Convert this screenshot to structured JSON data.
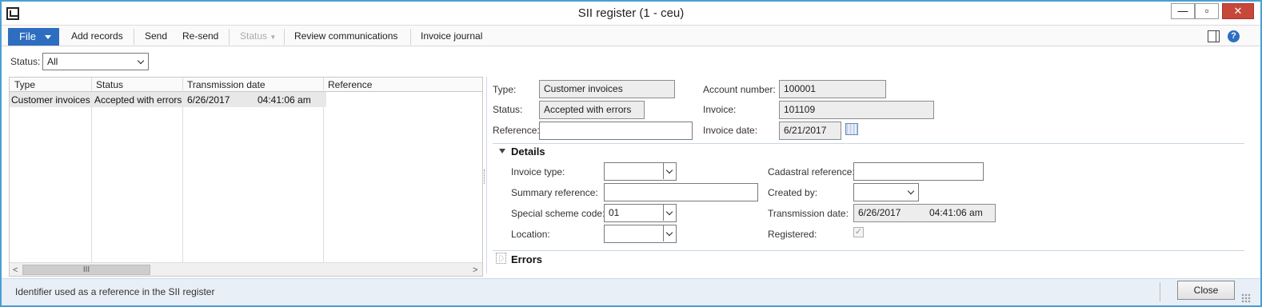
{
  "window": {
    "title": "SII register (1 - ceu)",
    "controls": {
      "minimize": "—",
      "maximize": "▫",
      "close": "✕"
    }
  },
  "ribbon": {
    "file": "File",
    "add_records": "Add records",
    "send": "Send",
    "resend": "Re-send",
    "status": "Status",
    "review": "Review communications",
    "invoice_journal": "Invoice journal",
    "help": "?"
  },
  "filter": {
    "label": "Status:",
    "value": "All"
  },
  "grid": {
    "columns": [
      "Type",
      "Status",
      "Transmission date",
      "Reference"
    ],
    "rows": [
      {
        "type": "Customer invoices",
        "status": "Accepted with errors",
        "date": "6/26/2017",
        "time": "04:41:06 am",
        "reference": ""
      }
    ],
    "scroll": {
      "left": "<",
      "thumb": "III",
      "right": ">"
    }
  },
  "header_fields": {
    "type_label": "Type:",
    "type_value": "Customer invoices",
    "status_label": "Status:",
    "status_value": "Accepted with errors",
    "reference_label": "Reference:",
    "reference_value": "",
    "account_label": "Account number:",
    "account_value": "100001",
    "invoice_label": "Invoice:",
    "invoice_value": "101109",
    "invoice_date_label": "Invoice date:",
    "invoice_date_value": "6/21/2017"
  },
  "details": {
    "title": "Details",
    "invoice_type_label": "Invoice type:",
    "invoice_type_value": "",
    "summary_ref_label": "Summary reference:",
    "summary_ref_value": "",
    "special_scheme_label": "Special scheme code:",
    "special_scheme_value": "01",
    "location_label": "Location:",
    "location_value": "",
    "cadastral_label": "Cadastral reference:",
    "cadastral_value": "",
    "created_by_label": "Created by:",
    "created_by_value": "",
    "transmission_label": "Transmission date:",
    "transmission_date": "6/26/2017",
    "transmission_time": "04:41:06 am",
    "registered_label": "Registered:",
    "registered_mark": "✓"
  },
  "errors": {
    "title": "Errors"
  },
  "statusbar": {
    "text": "Identifier used as a reference in the SII register",
    "close": "Close"
  }
}
